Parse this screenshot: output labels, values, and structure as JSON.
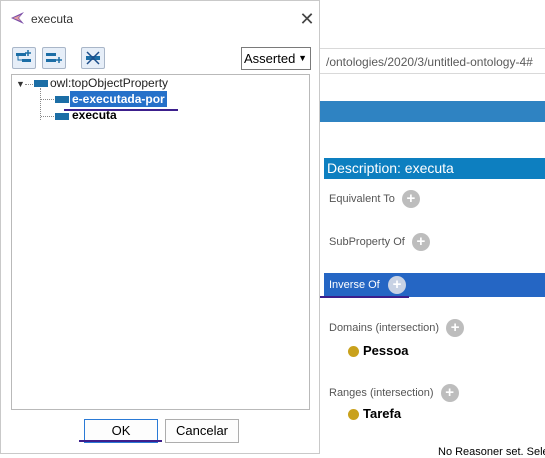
{
  "dialog": {
    "title": "executa",
    "toolbar": {
      "add_sub_icon": "add-subproperty-icon",
      "add_sibling_icon": "add-sibling-property-icon",
      "delete_icon": "delete-property-icon"
    },
    "view_select": {
      "selected": "Asserted"
    },
    "tree": {
      "root": "owl:topObjectProperty",
      "children": [
        "e-executada-por",
        "executa"
      ],
      "selected": "e-executada-por"
    },
    "buttons": {
      "ok": "OK",
      "cancel": "Cancelar"
    }
  },
  "background": {
    "url_fragment": "/ontologies/2020/3/untitled-ontology-4#",
    "description_header": "Description: executa",
    "sections": {
      "equivalent": "Equivalent To",
      "subproperty": "SubProperty Of",
      "inverse": "Inverse Of",
      "domains": "Domains (intersection)",
      "ranges": "Ranges (intersection)"
    },
    "domain_value": "Pessoa",
    "range_value": "Tarefa",
    "add_glyph": "+",
    "status": "No Reasoner set. Select"
  },
  "colors": {
    "selection": "#2671c9",
    "header_blue": "#0d7fc0",
    "annotation_underline": "#3c1f8c",
    "class_dot": "#c9a11c"
  }
}
